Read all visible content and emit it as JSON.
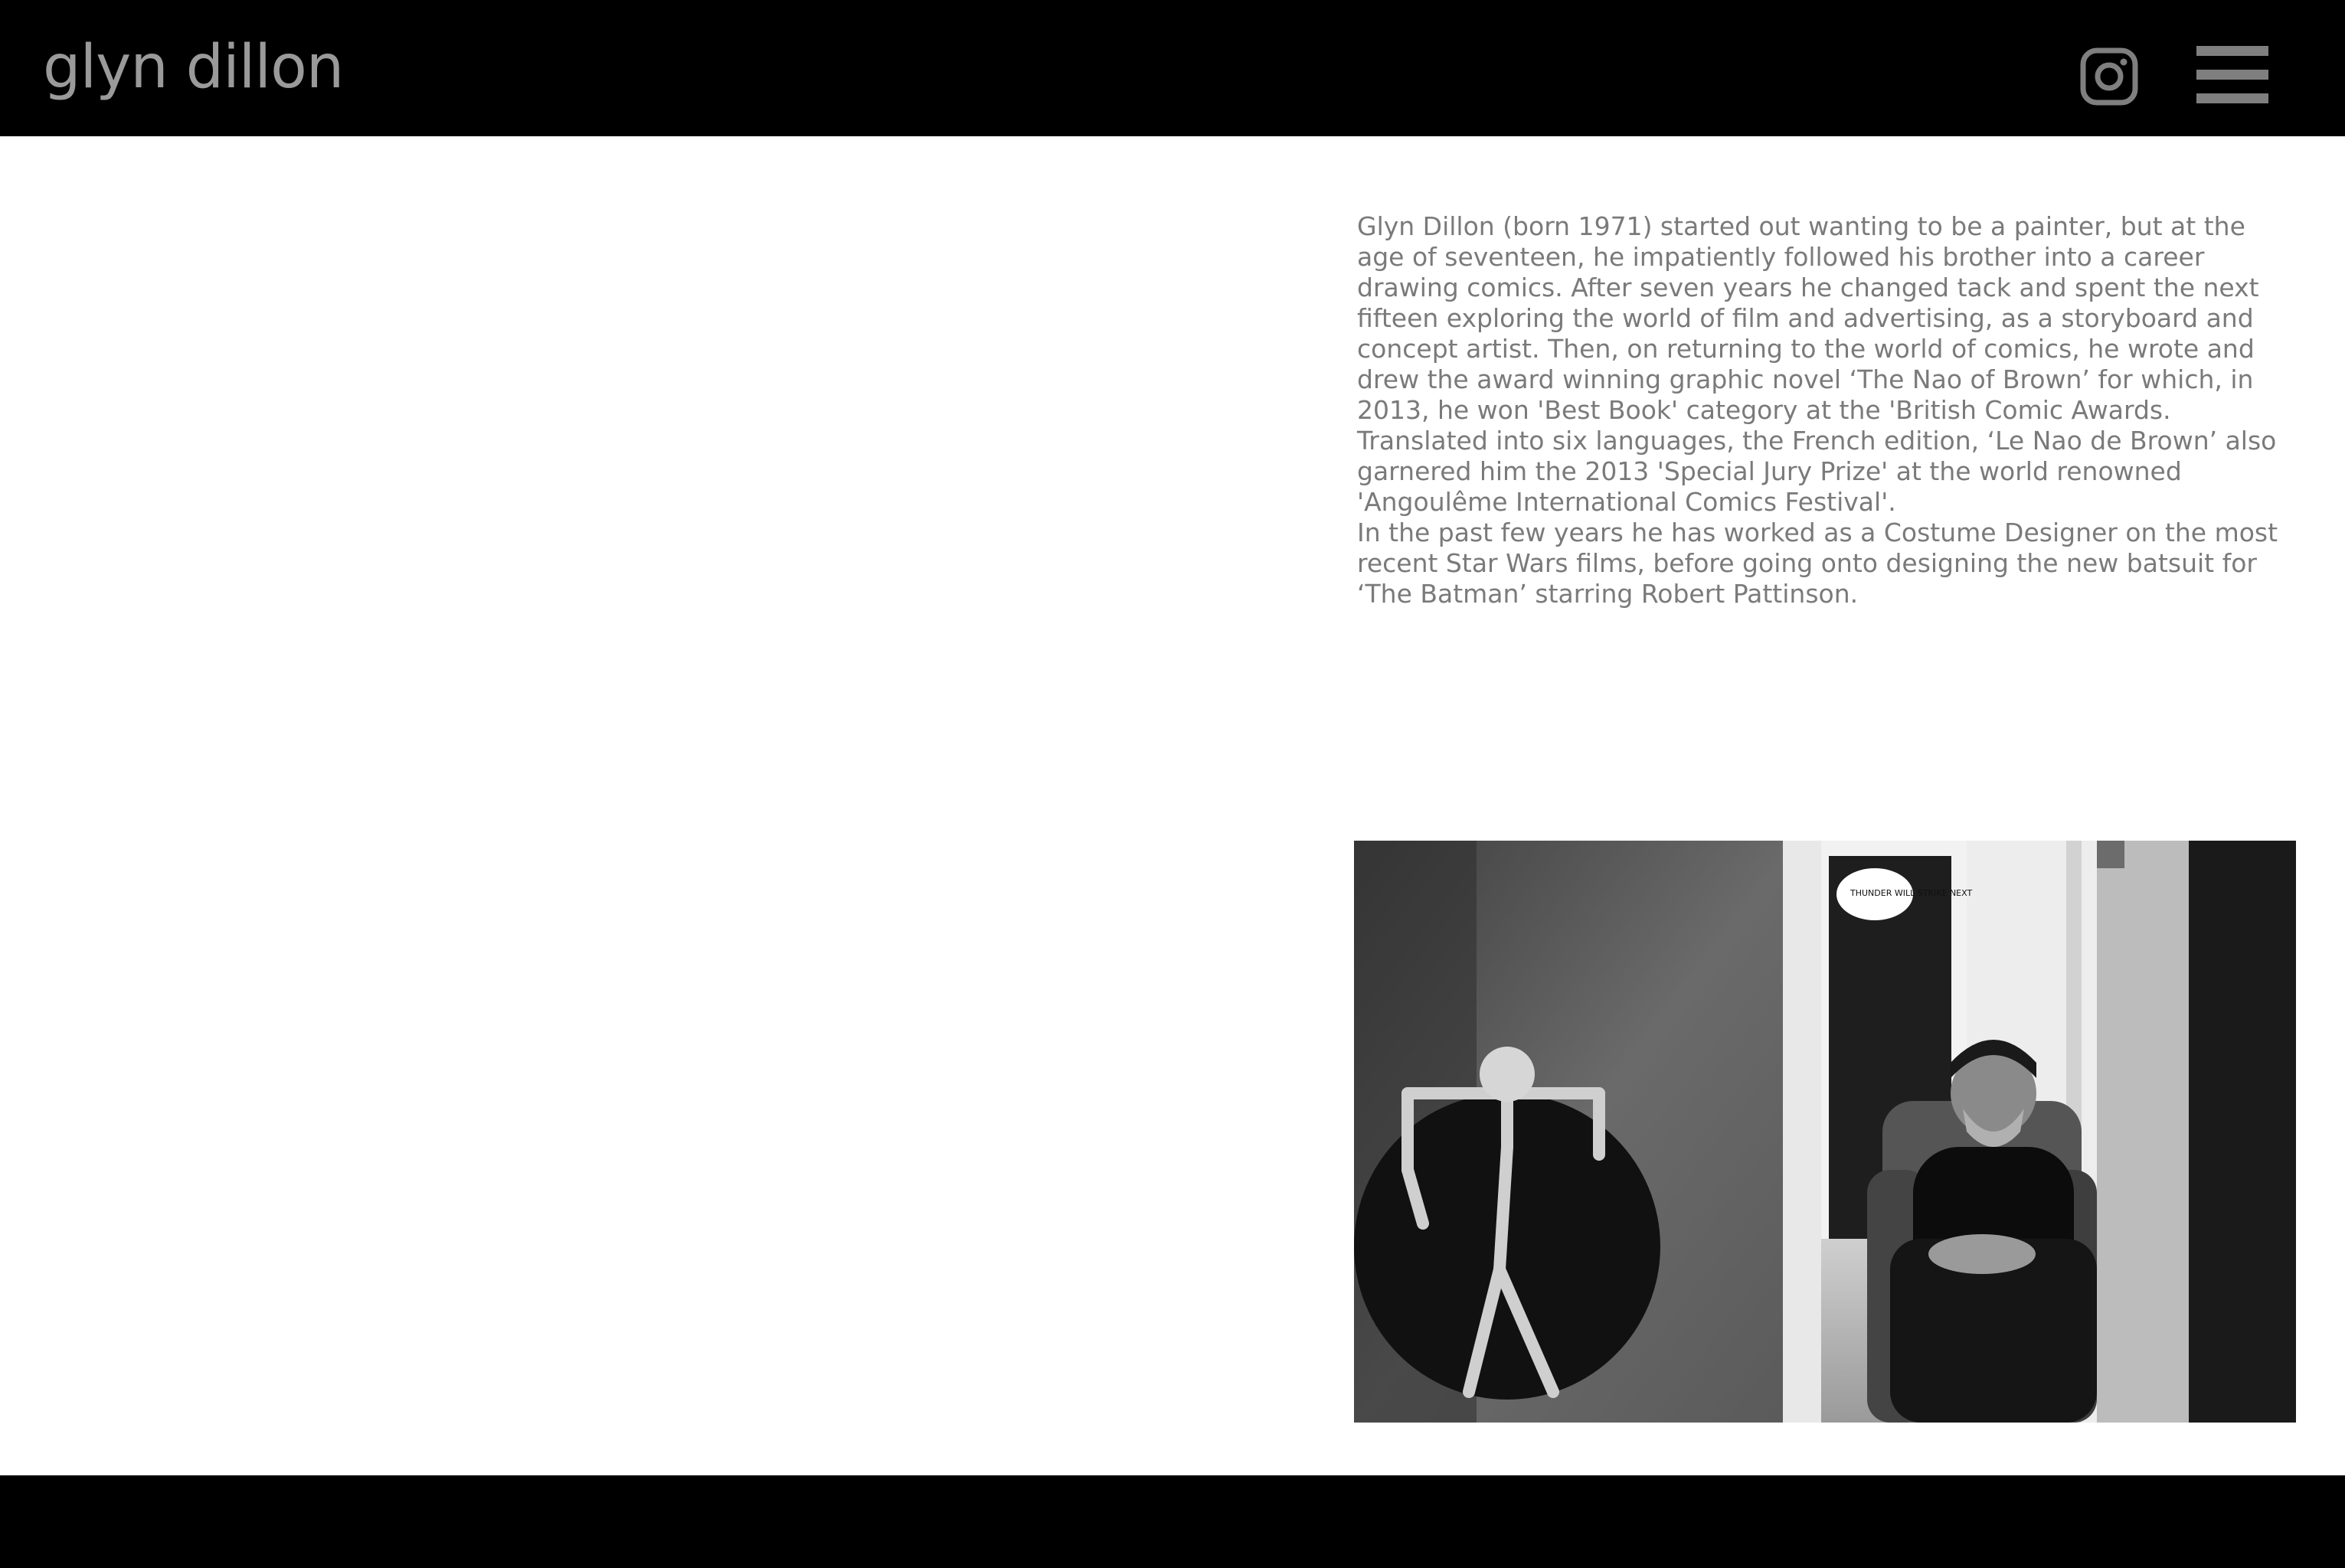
{
  "header": {
    "site_title": "glyn dillon",
    "instagram_icon": "instagram-icon",
    "menu_icon": "hamburger-menu-icon"
  },
  "bio": {
    "paragraph_1": "Glyn Dillon (born 1971) started out wanting to be a painter, but at the age of seventeen, he impatiently followed his brother into a career drawing comics. After seven years he changed tack and spent the next fifteen exploring the world of film and advertising, as a storyboard and concept artist. Then, on returning to the world of comics, he wrote and drew the award winning graphic novel ‘The Nao of Brown’ for which, in 2013, he won 'Best Book' category at the 'British Comic Awards. Translated into six languages, the French edition, ‘Le Nao de Brown’ also garnered him the 2013 'Special Jury Prize' at the world renowned 'Angoulême International Comics Festival'.",
    "paragraph_2": "In the past few years he has worked as a Costume Designer on the most recent Star Wars films, before going onto designing the new batsuit for ‘The Batman’ starring Robert Pattinson."
  },
  "photo": {
    "sign_text": "THUNDER WILL STRIKE NEXT"
  },
  "colors": {
    "bar_background": "#000000",
    "title_gray": "#9a9a9a",
    "icon_gray": "#7f7f7f",
    "body_text": "#7a7a7a"
  }
}
